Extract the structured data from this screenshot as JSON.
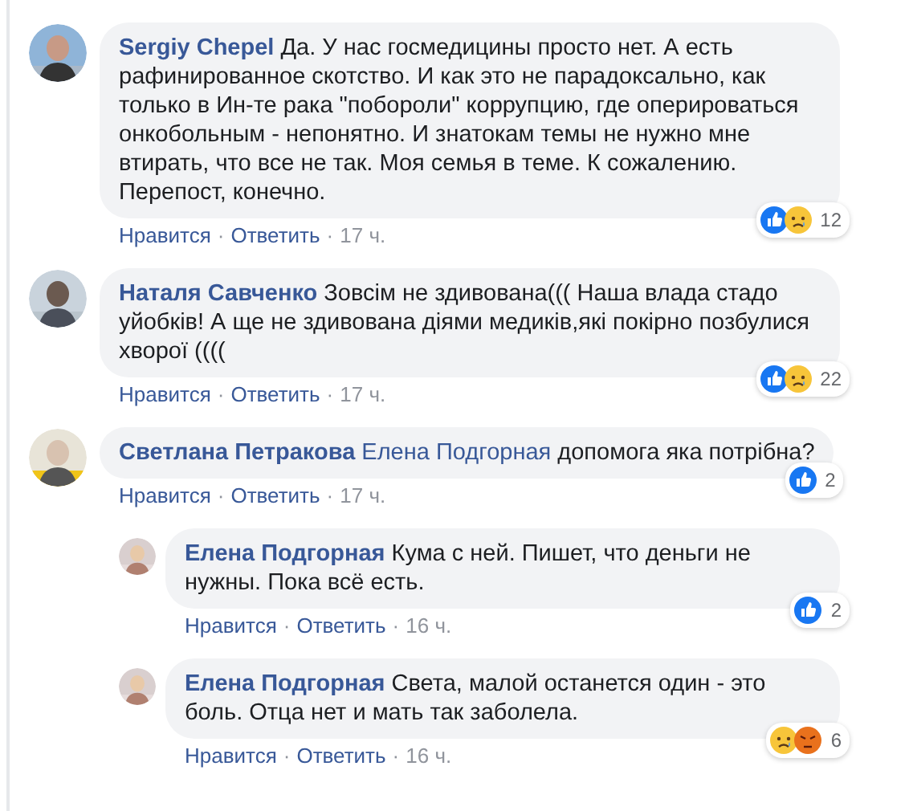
{
  "separator": "·",
  "comments": [
    {
      "author": "Sergiy Chepel",
      "text": "Да. У нас госмедицины просто нет. А есть рафинированное скотство. И как это не парадоксально, как только в Ин-те рака \"побороли\" коррупцию, где оперироваться онкобольным - непонятно. И знатокам темы не нужно мне втирать, что все не так. Моя семья в теме. К сожалению. Перепост, конечно.",
      "reactions": [
        {
          "kind": "like"
        },
        {
          "kind": "sad"
        }
      ],
      "reaction_count": "12",
      "actions": [
        "Нравится",
        "Ответить"
      ],
      "time": "17 ч."
    },
    {
      "author": "Наталя Савченко",
      "text": "Зовсім не здивована((( Наша влада стадо уйобків! А ще не здивована діями медиків,які покірно позбулися хворої ((((",
      "reactions": [
        {
          "kind": "like"
        },
        {
          "kind": "sad"
        }
      ],
      "reaction_count": "22",
      "actions": [
        "Нравится",
        "Ответить"
      ],
      "time": "17 ч."
    },
    {
      "author": "Светлана Петракова",
      "mention": "Елена Подгорная",
      "text": "допомога яка потрібна?",
      "reactions": [
        {
          "kind": "like"
        }
      ],
      "reaction_count": "2",
      "actions": [
        "Нравится",
        "Ответить"
      ],
      "time": "17 ч.",
      "children": [
        {
          "author": "Елена Подгорная",
          "text": "Кума с ней. Пишет, что деньги не нужны. Пока всё есть.",
          "reactions": [
            {
              "kind": "like"
            }
          ],
          "reaction_count": "2",
          "actions": [
            "Нравится",
            "Ответить"
          ],
          "time": "16 ч."
        },
        {
          "author": "Елена Подгорная",
          "text": "Света, малой останется один - это боль. Отца нет и мать так заболела.",
          "reactions": [
            {
              "kind": "sad"
            },
            {
              "kind": "angry"
            }
          ],
          "reaction_count": "6",
          "actions": [
            "Нравится",
            "Ответить"
          ],
          "time": "16 ч."
        }
      ]
    }
  ]
}
